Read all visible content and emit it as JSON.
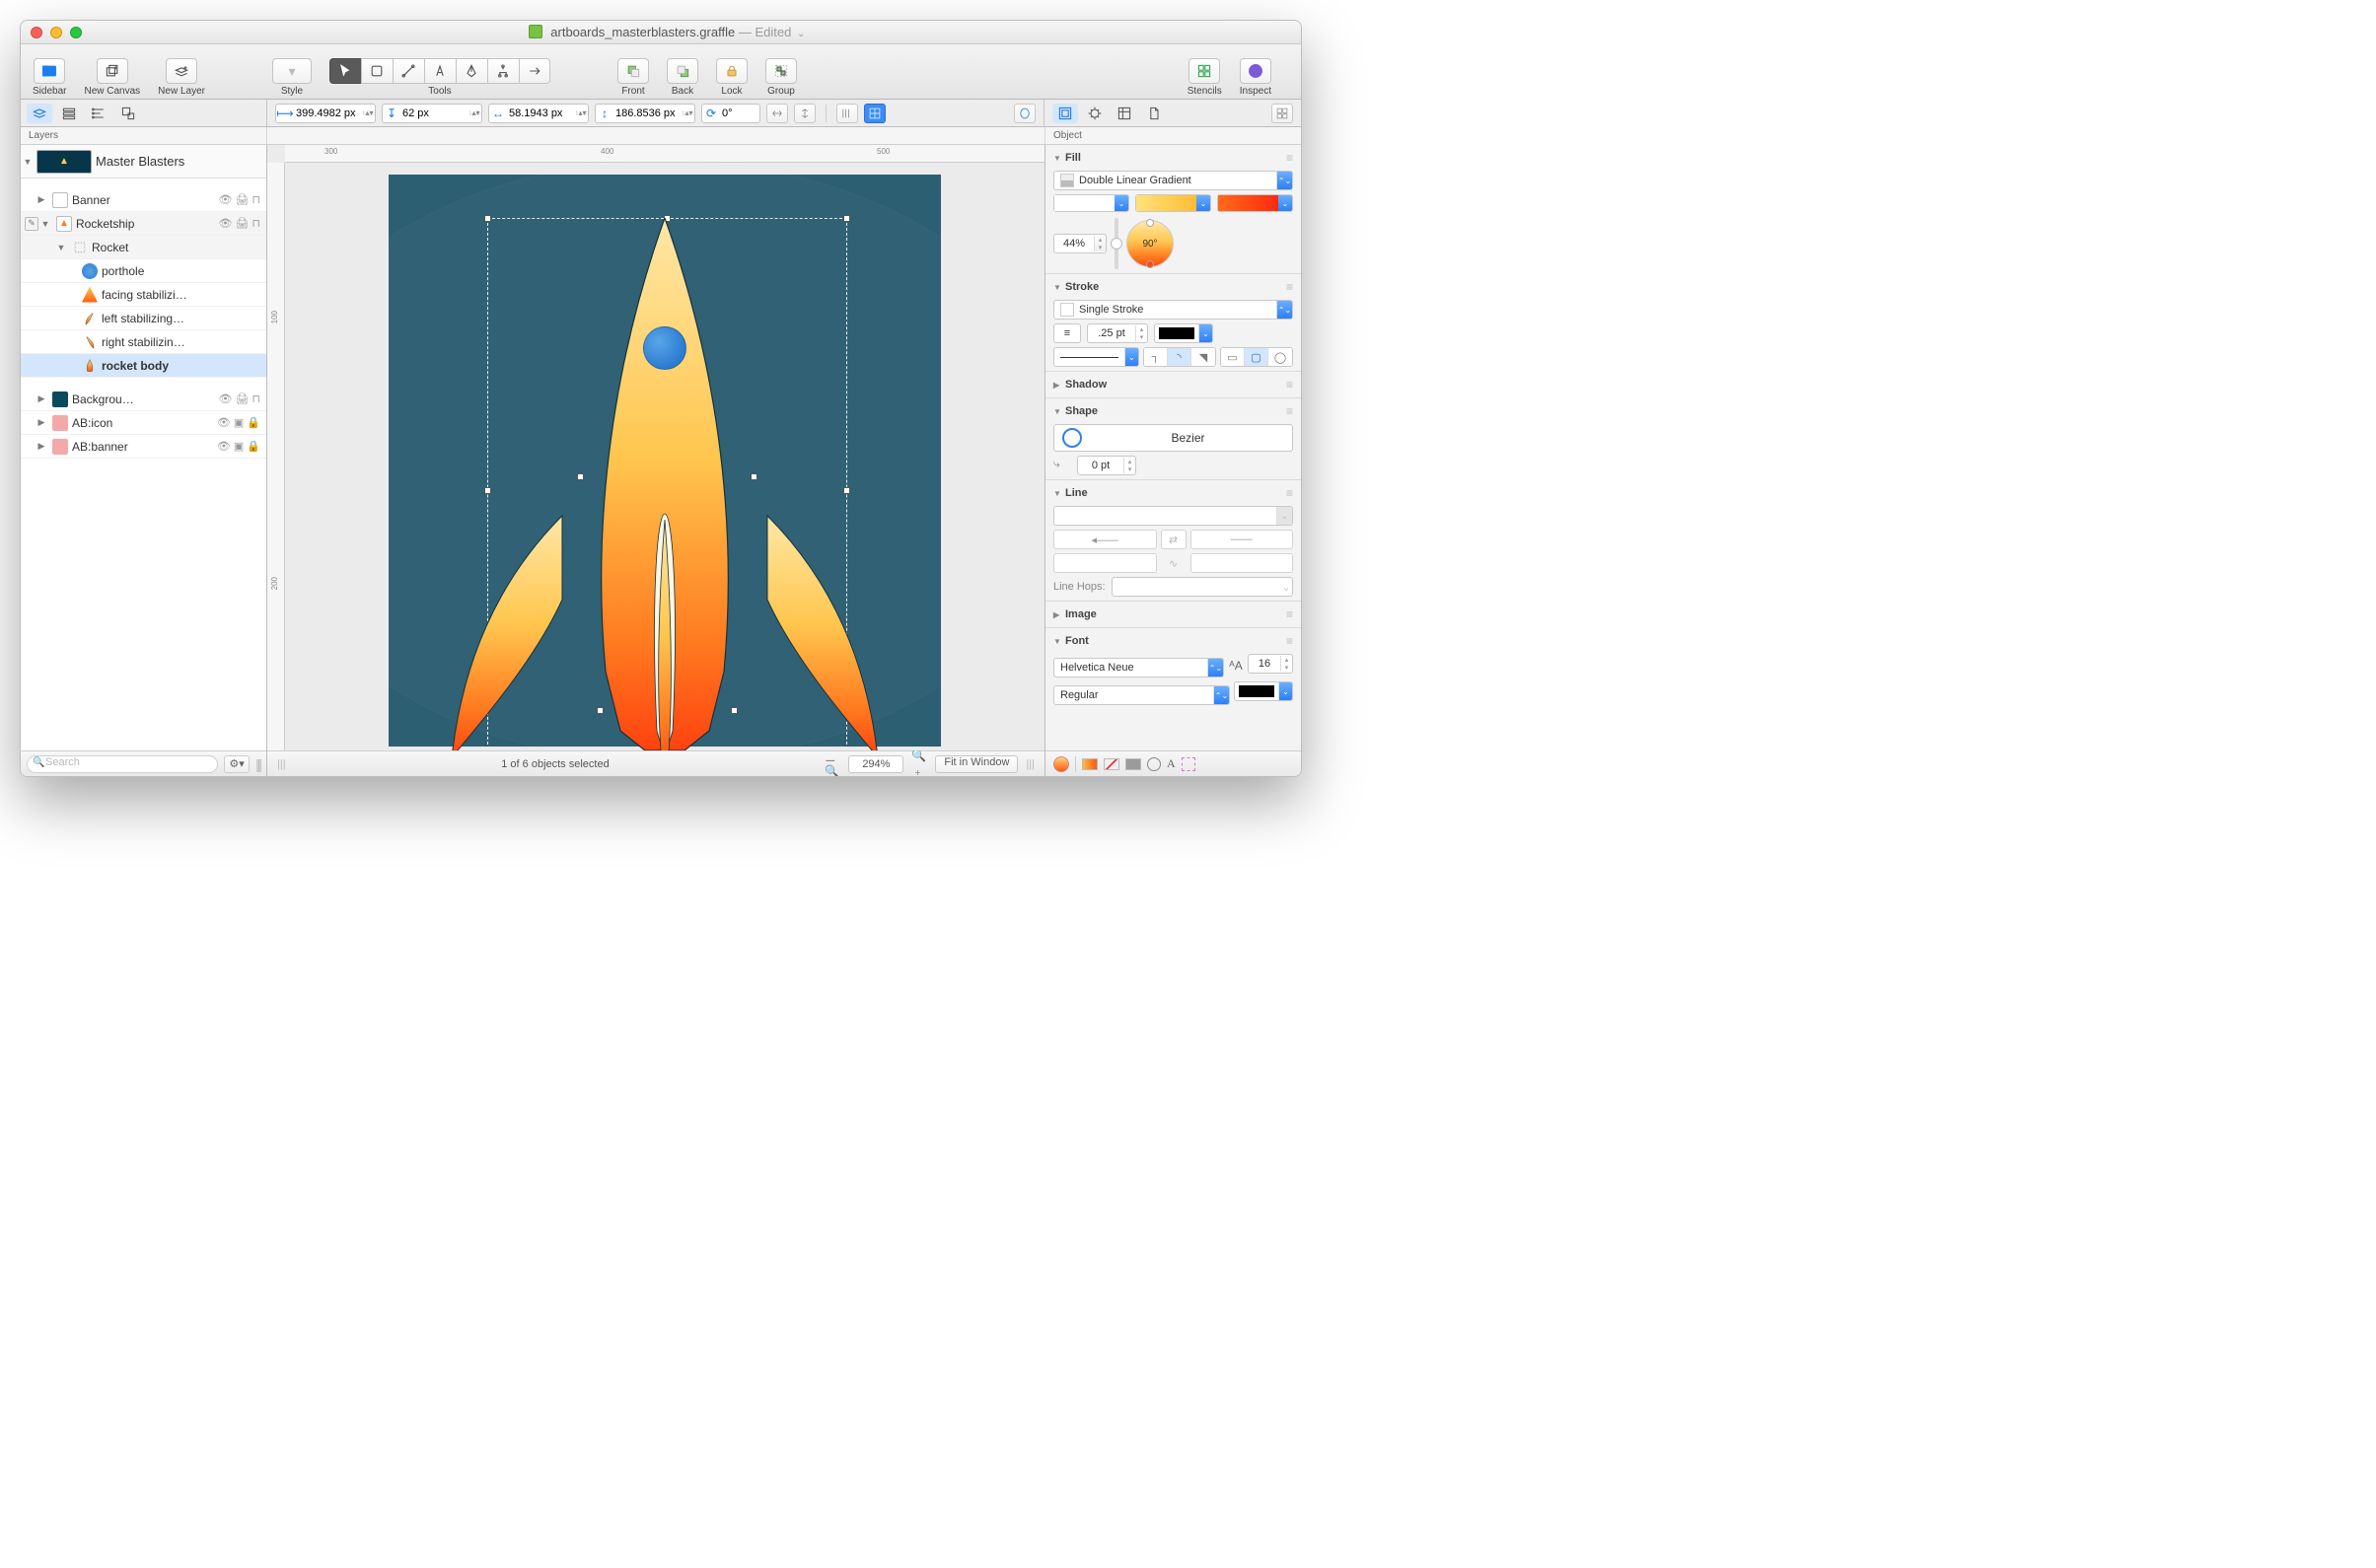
{
  "title": {
    "filename": "artboards_masterblasters.graffle",
    "status": "Edited"
  },
  "toolbar": {
    "sidebar": "Sidebar",
    "newCanvas": "New Canvas",
    "newLayer": "New Layer",
    "style": "Style",
    "tools": "Tools",
    "front": "Front",
    "back": "Back",
    "lock": "Lock",
    "group": "Group",
    "stencils": "Stencils",
    "inspect": "Inspect"
  },
  "measurements": {
    "x": "399.4982 px",
    "y": "62 px",
    "w": "58.1943 px",
    "h": "186.8536 px",
    "rot": "0°"
  },
  "panelHeaders": {
    "layers": "Layers",
    "object": "Object"
  },
  "layers": {
    "canvasName": "Master Blasters",
    "items": [
      {
        "name": "Banner",
        "kind": "layer",
        "expanded": false
      },
      {
        "name": "Rocketship",
        "kind": "layer",
        "expanded": true,
        "active": true,
        "children": [
          {
            "name": "Rocket",
            "kind": "group",
            "expanded": true,
            "children": [
              {
                "name": "porthole"
              },
              {
                "name": "facing stabilizi…"
              },
              {
                "name": "left stabilizing…"
              },
              {
                "name": "right stabilizin…"
              },
              {
                "name": "rocket body",
                "selected": true
              }
            ]
          }
        ]
      },
      {
        "name": "Backgrou…",
        "kind": "layer",
        "expanded": false
      },
      {
        "name": "AB:icon",
        "kind": "layer",
        "expanded": false,
        "locked": true,
        "artboard": true
      },
      {
        "name": "AB:banner",
        "kind": "layer",
        "expanded": false,
        "locked": true,
        "artboard": true
      }
    ],
    "searchPlaceholder": "Search"
  },
  "ruler": {
    "h": [
      "300",
      "400",
      "500"
    ],
    "v": [
      "100",
      "200"
    ]
  },
  "canvasFooter": {
    "status": "1 of 6 objects selected",
    "zoom": "294%",
    "fit": "Fit in Window"
  },
  "inspector": {
    "fill": {
      "title": "Fill",
      "type": "Double Linear Gradient",
      "stops": [
        "#ffffff",
        "#ffc734",
        "#ff3a10"
      ],
      "midpoint": "44%",
      "angle": "90°"
    },
    "stroke": {
      "title": "Stroke",
      "type": "Single Stroke",
      "width": ".25 pt",
      "color": "#000000"
    },
    "shadow": {
      "title": "Shadow"
    },
    "shape": {
      "title": "Shape",
      "name": "Bezier",
      "corner": "0 pt"
    },
    "line": {
      "title": "Line",
      "hopsLabel": "Line Hops:"
    },
    "image": {
      "title": "Image"
    },
    "font": {
      "title": "Font",
      "family": "Helvetica Neue",
      "size": "16",
      "weight": "Regular",
      "color": "#000000"
    }
  }
}
